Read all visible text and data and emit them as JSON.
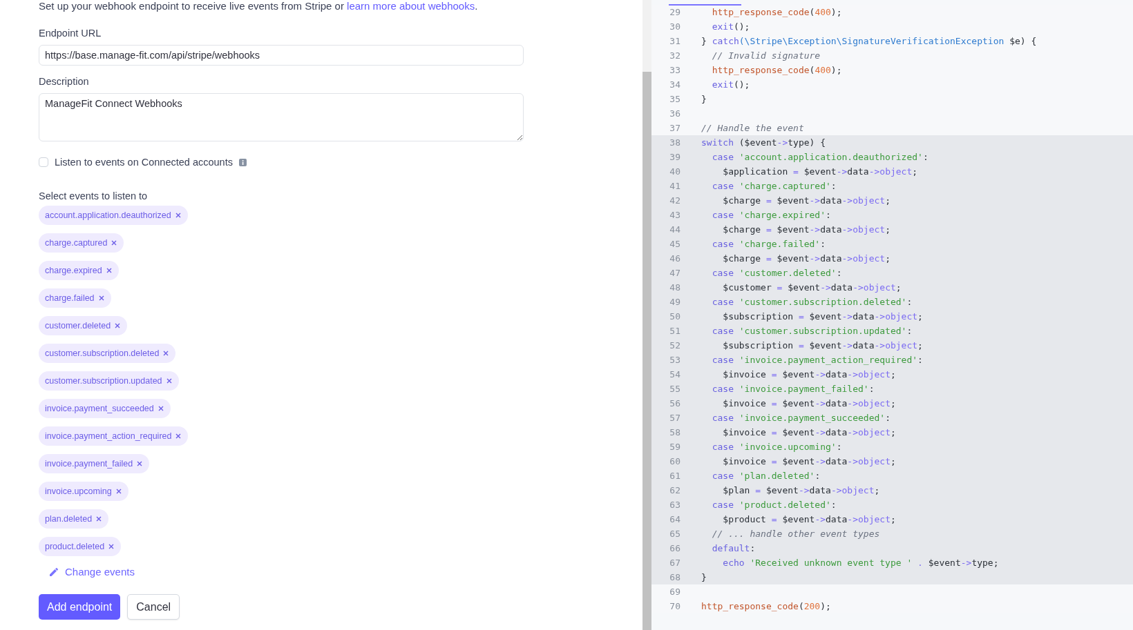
{
  "form": {
    "intro": {
      "text": "Set up your webhook endpoint to receive live events from Stripe or ",
      "link": "learn more about webhooks",
      "end": "."
    },
    "endpoint_url": {
      "label": "Endpoint URL",
      "value": "https://base.manage-fit.com/api/stripe/webhooks"
    },
    "description": {
      "label": "Description",
      "value": "ManageFit Connect Webhooks"
    },
    "connected_accounts": {
      "label": "Listen to events on Connected accounts",
      "checked": false
    },
    "events_label": "Select events to listen to",
    "events": [
      {
        "label": "account.application.deauthorized"
      },
      {
        "label": "charge.captured"
      },
      {
        "label": "charge.expired"
      },
      {
        "label": "charge.failed"
      },
      {
        "label": "customer.deleted"
      },
      {
        "label": "customer.subscription.deleted"
      },
      {
        "label": "customer.subscription.updated"
      },
      {
        "label": "invoice.payment_succeeded"
      },
      {
        "label": "invoice.payment_action_required"
      },
      {
        "label": "invoice.payment_failed"
      },
      {
        "label": "invoice.upcoming"
      },
      {
        "label": "plan.deleted"
      },
      {
        "label": "product.deleted"
      }
    ],
    "change_events": "Change events",
    "buttons": [
      {
        "label": "Add endpoint",
        "kind": "primary"
      },
      {
        "label": "Cancel",
        "kind": "secondary"
      }
    ]
  },
  "code": {
    "lines": [
      {
        "number": "29",
        "highlighted": false,
        "tokens": [
          {
            "kind": "fn",
            "text": "  http_response_code"
          },
          {
            "kind": "plain",
            "text": "("
          },
          {
            "kind": "num",
            "text": "400"
          },
          {
            "kind": "plain",
            "text": ");"
          }
        ]
      },
      {
        "number": "30",
        "highlighted": false,
        "tokens": [
          {
            "kind": "kw",
            "text": "  exit"
          },
          {
            "kind": "plain",
            "text": "();"
          }
        ]
      },
      {
        "number": "31",
        "highlighted": false,
        "tokens": [
          {
            "kind": "plain",
            "text": "} "
          },
          {
            "kind": "kw",
            "text": "catch"
          },
          {
            "kind": "cls",
            "text": "(\\Stripe\\Exception\\SignatureVerificationException"
          },
          {
            "kind": "plain",
            "text": " $e) {"
          }
        ]
      },
      {
        "number": "32",
        "highlighted": false,
        "tokens": [
          {
            "kind": "cmt",
            "text": "  // Invalid signature"
          }
        ]
      },
      {
        "number": "33",
        "highlighted": false,
        "tokens": [
          {
            "kind": "fn",
            "text": "  http_response_code"
          },
          {
            "kind": "plain",
            "text": "("
          },
          {
            "kind": "num",
            "text": "400"
          },
          {
            "kind": "plain",
            "text": ");"
          }
        ]
      },
      {
        "number": "34",
        "highlighted": false,
        "tokens": [
          {
            "kind": "kw",
            "text": "  exit"
          },
          {
            "kind": "plain",
            "text": "();"
          }
        ]
      },
      {
        "number": "35",
        "highlighted": false,
        "tokens": [
          {
            "kind": "plain",
            "text": "}"
          }
        ]
      },
      {
        "number": "36",
        "highlighted": false
      },
      {
        "number": "37",
        "highlighted": false,
        "tokens": [
          {
            "kind": "cmt",
            "text": "// Handle the event"
          }
        ]
      },
      {
        "number": "38",
        "highlighted": true,
        "tokens": [
          {
            "kind": "kw",
            "text": "switch"
          },
          {
            "kind": "plain",
            "text": " ($event"
          },
          {
            "kind": "op",
            "text": "->"
          },
          {
            "kind": "plain",
            "text": "type) {"
          }
        ]
      },
      {
        "number": "39",
        "highlighted": true,
        "tokens": [
          {
            "kind": "kw",
            "text": "  case"
          },
          {
            "kind": "str",
            "text": " 'account.application.deauthorized'"
          },
          {
            "kind": "plain",
            "text": ":"
          }
        ]
      },
      {
        "number": "40",
        "highlighted": true,
        "tokens": [
          {
            "kind": "plain",
            "text": "    $application "
          },
          {
            "kind": "op",
            "text": "="
          },
          {
            "kind": "plain",
            "text": " $event"
          },
          {
            "kind": "op",
            "text": "->"
          },
          {
            "kind": "plain",
            "text": "data"
          },
          {
            "kind": "op",
            "text": "->object"
          },
          {
            "kind": "plain",
            "text": ";"
          }
        ]
      },
      {
        "number": "41",
        "highlighted": true,
        "tokens": [
          {
            "kind": "kw",
            "text": "  case"
          },
          {
            "kind": "str",
            "text": " 'charge.captured'"
          },
          {
            "kind": "plain",
            "text": ":"
          }
        ]
      },
      {
        "number": "42",
        "highlighted": true,
        "tokens": [
          {
            "kind": "plain",
            "text": "    $charge "
          },
          {
            "kind": "op",
            "text": "="
          },
          {
            "kind": "plain",
            "text": " $event"
          },
          {
            "kind": "op",
            "text": "->"
          },
          {
            "kind": "plain",
            "text": "data"
          },
          {
            "kind": "op",
            "text": "->object"
          },
          {
            "kind": "plain",
            "text": ";"
          }
        ]
      },
      {
        "number": "43",
        "highlighted": true,
        "tokens": [
          {
            "kind": "kw",
            "text": "  case"
          },
          {
            "kind": "str",
            "text": " 'charge.expired'"
          },
          {
            "kind": "plain",
            "text": ":"
          }
        ]
      },
      {
        "number": "44",
        "highlighted": true,
        "tokens": [
          {
            "kind": "plain",
            "text": "    $charge "
          },
          {
            "kind": "op",
            "text": "="
          },
          {
            "kind": "plain",
            "text": " $event"
          },
          {
            "kind": "op",
            "text": "->"
          },
          {
            "kind": "plain",
            "text": "data"
          },
          {
            "kind": "op",
            "text": "->object"
          },
          {
            "kind": "plain",
            "text": ";"
          }
        ]
      },
      {
        "number": "45",
        "highlighted": true,
        "tokens": [
          {
            "kind": "kw",
            "text": "  case"
          },
          {
            "kind": "str",
            "text": " 'charge.failed'"
          },
          {
            "kind": "plain",
            "text": ":"
          }
        ]
      },
      {
        "number": "46",
        "highlighted": true,
        "tokens": [
          {
            "kind": "plain",
            "text": "    $charge "
          },
          {
            "kind": "op",
            "text": "="
          },
          {
            "kind": "plain",
            "text": " $event"
          },
          {
            "kind": "op",
            "text": "->"
          },
          {
            "kind": "plain",
            "text": "data"
          },
          {
            "kind": "op",
            "text": "->object"
          },
          {
            "kind": "plain",
            "text": ";"
          }
        ]
      },
      {
        "number": "47",
        "highlighted": true,
        "tokens": [
          {
            "kind": "kw",
            "text": "  case"
          },
          {
            "kind": "str",
            "text": " 'customer.deleted'"
          },
          {
            "kind": "plain",
            "text": ":"
          }
        ]
      },
      {
        "number": "48",
        "highlighted": true,
        "tokens": [
          {
            "kind": "plain",
            "text": "    $customer "
          },
          {
            "kind": "op",
            "text": "="
          },
          {
            "kind": "plain",
            "text": " $event"
          },
          {
            "kind": "op",
            "text": "->"
          },
          {
            "kind": "plain",
            "text": "data"
          },
          {
            "kind": "op",
            "text": "->object"
          },
          {
            "kind": "plain",
            "text": ";"
          }
        ]
      },
      {
        "number": "49",
        "highlighted": true,
        "tokens": [
          {
            "kind": "kw",
            "text": "  case"
          },
          {
            "kind": "str",
            "text": " 'customer.subscription.deleted'"
          },
          {
            "kind": "plain",
            "text": ":"
          }
        ]
      },
      {
        "number": "50",
        "highlighted": true,
        "tokens": [
          {
            "kind": "plain",
            "text": "    $subscription "
          },
          {
            "kind": "op",
            "text": "="
          },
          {
            "kind": "plain",
            "text": " $event"
          },
          {
            "kind": "op",
            "text": "->"
          },
          {
            "kind": "plain",
            "text": "data"
          },
          {
            "kind": "op",
            "text": "->object"
          },
          {
            "kind": "plain",
            "text": ";"
          }
        ]
      },
      {
        "number": "51",
        "highlighted": true,
        "tokens": [
          {
            "kind": "kw",
            "text": "  case"
          },
          {
            "kind": "str",
            "text": " 'customer.subscription.updated'"
          },
          {
            "kind": "plain",
            "text": ":"
          }
        ]
      },
      {
        "number": "52",
        "highlighted": true,
        "tokens": [
          {
            "kind": "plain",
            "text": "    $subscription "
          },
          {
            "kind": "op",
            "text": "="
          },
          {
            "kind": "plain",
            "text": " $event"
          },
          {
            "kind": "op",
            "text": "->"
          },
          {
            "kind": "plain",
            "text": "data"
          },
          {
            "kind": "op",
            "text": "->object"
          },
          {
            "kind": "plain",
            "text": ";"
          }
        ]
      },
      {
        "number": "53",
        "highlighted": true,
        "tokens": [
          {
            "kind": "kw",
            "text": "  case"
          },
          {
            "kind": "str",
            "text": " 'invoice.payment_action_required'"
          },
          {
            "kind": "plain",
            "text": ":"
          }
        ]
      },
      {
        "number": "54",
        "highlighted": true,
        "tokens": [
          {
            "kind": "plain",
            "text": "    $invoice "
          },
          {
            "kind": "op",
            "text": "="
          },
          {
            "kind": "plain",
            "text": " $event"
          },
          {
            "kind": "op",
            "text": "->"
          },
          {
            "kind": "plain",
            "text": "data"
          },
          {
            "kind": "op",
            "text": "->object"
          },
          {
            "kind": "plain",
            "text": ";"
          }
        ]
      },
      {
        "number": "55",
        "highlighted": true,
        "tokens": [
          {
            "kind": "kw",
            "text": "  case"
          },
          {
            "kind": "str",
            "text": " 'invoice.payment_failed'"
          },
          {
            "kind": "plain",
            "text": ":"
          }
        ]
      },
      {
        "number": "56",
        "highlighted": true,
        "tokens": [
          {
            "kind": "plain",
            "text": "    $invoice "
          },
          {
            "kind": "op",
            "text": "="
          },
          {
            "kind": "plain",
            "text": " $event"
          },
          {
            "kind": "op",
            "text": "->"
          },
          {
            "kind": "plain",
            "text": "data"
          },
          {
            "kind": "op",
            "text": "->object"
          },
          {
            "kind": "plain",
            "text": ";"
          }
        ]
      },
      {
        "number": "57",
        "highlighted": true,
        "tokens": [
          {
            "kind": "kw",
            "text": "  case"
          },
          {
            "kind": "str",
            "text": " 'invoice.payment_succeeded'"
          },
          {
            "kind": "plain",
            "text": ":"
          }
        ]
      },
      {
        "number": "58",
        "highlighted": true,
        "tokens": [
          {
            "kind": "plain",
            "text": "    $invoice "
          },
          {
            "kind": "op",
            "text": "="
          },
          {
            "kind": "plain",
            "text": " $event"
          },
          {
            "kind": "op",
            "text": "->"
          },
          {
            "kind": "plain",
            "text": "data"
          },
          {
            "kind": "op",
            "text": "->object"
          },
          {
            "kind": "plain",
            "text": ";"
          }
        ]
      },
      {
        "number": "59",
        "highlighted": true,
        "tokens": [
          {
            "kind": "kw",
            "text": "  case"
          },
          {
            "kind": "str",
            "text": " 'invoice.upcoming'"
          },
          {
            "kind": "plain",
            "text": ":"
          }
        ]
      },
      {
        "number": "60",
        "highlighted": true,
        "tokens": [
          {
            "kind": "plain",
            "text": "    $invoice "
          },
          {
            "kind": "op",
            "text": "="
          },
          {
            "kind": "plain",
            "text": " $event"
          },
          {
            "kind": "op",
            "text": "->"
          },
          {
            "kind": "plain",
            "text": "data"
          },
          {
            "kind": "op",
            "text": "->object"
          },
          {
            "kind": "plain",
            "text": ";"
          }
        ]
      },
      {
        "number": "61",
        "highlighted": true,
        "tokens": [
          {
            "kind": "kw",
            "text": "  case"
          },
          {
            "kind": "str",
            "text": " 'plan.deleted'"
          },
          {
            "kind": "plain",
            "text": ":"
          }
        ]
      },
      {
        "number": "62",
        "highlighted": true,
        "tokens": [
          {
            "kind": "plain",
            "text": "    $plan "
          },
          {
            "kind": "op",
            "text": "="
          },
          {
            "kind": "plain",
            "text": " $event"
          },
          {
            "kind": "op",
            "text": "->"
          },
          {
            "kind": "plain",
            "text": "data"
          },
          {
            "kind": "op",
            "text": "->object"
          },
          {
            "kind": "plain",
            "text": ";"
          }
        ]
      },
      {
        "number": "63",
        "highlighted": true,
        "tokens": [
          {
            "kind": "kw",
            "text": "  case"
          },
          {
            "kind": "str",
            "text": " 'product.deleted'"
          },
          {
            "kind": "plain",
            "text": ":"
          }
        ]
      },
      {
        "number": "64",
        "highlighted": true,
        "tokens": [
          {
            "kind": "plain",
            "text": "    $product "
          },
          {
            "kind": "op",
            "text": "="
          },
          {
            "kind": "plain",
            "text": " $event"
          },
          {
            "kind": "op",
            "text": "->"
          },
          {
            "kind": "plain",
            "text": "data"
          },
          {
            "kind": "op",
            "text": "->object"
          },
          {
            "kind": "plain",
            "text": ";"
          }
        ]
      },
      {
        "number": "65",
        "highlighted": true,
        "tokens": [
          {
            "kind": "cmt",
            "text": "  // ... handle other event types"
          }
        ]
      },
      {
        "number": "66",
        "highlighted": true,
        "tokens": [
          {
            "kind": "kw",
            "text": "  default"
          },
          {
            "kind": "plain",
            "text": ":"
          }
        ]
      },
      {
        "number": "67",
        "highlighted": true,
        "tokens": [
          {
            "kind": "kw",
            "text": "    echo"
          },
          {
            "kind": "str",
            "text": " 'Received unknown event type '"
          },
          {
            "kind": "op",
            "text": " ."
          },
          {
            "kind": "plain",
            "text": " $event"
          },
          {
            "kind": "op",
            "text": "->"
          },
          {
            "kind": "plain",
            "text": "type;"
          }
        ]
      },
      {
        "number": "68",
        "highlighted": true,
        "tokens": [
          {
            "kind": "plain",
            "text": "}"
          }
        ]
      },
      {
        "number": "69",
        "highlighted": false
      },
      {
        "number": "70",
        "highlighted": false,
        "tokens": [
          {
            "kind": "fn",
            "text": "http_response_code"
          },
          {
            "kind": "plain",
            "text": "("
          },
          {
            "kind": "num",
            "text": "200"
          },
          {
            "kind": "plain",
            "text": ");"
          }
        ]
      }
    ]
  }
}
